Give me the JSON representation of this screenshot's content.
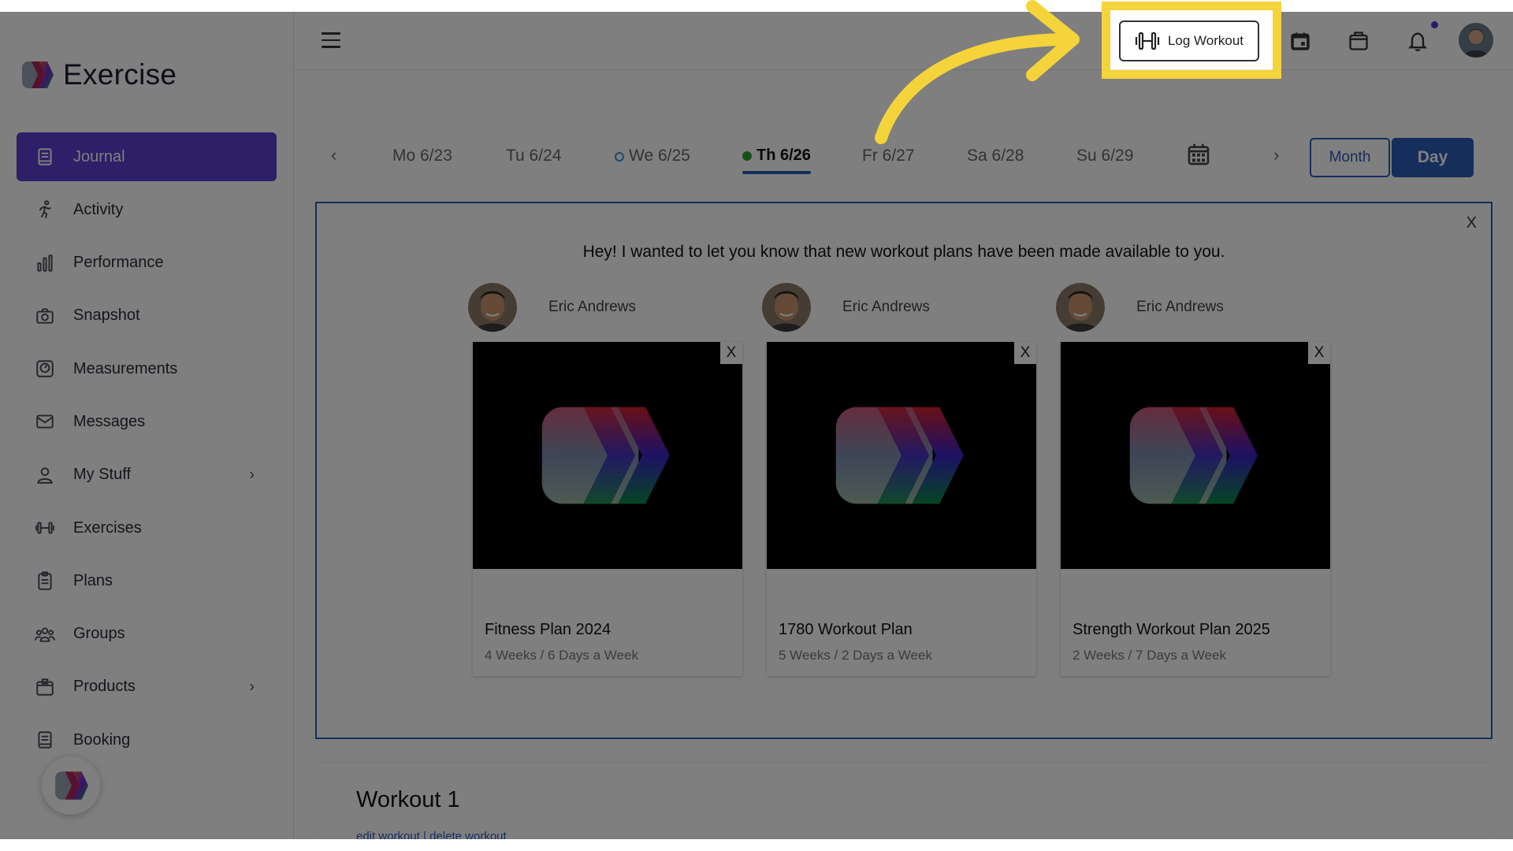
{
  "brand": {
    "name": "Exercise"
  },
  "sidebar": {
    "items": [
      {
        "label": "Journal",
        "icon": "journal-icon",
        "active": true
      },
      {
        "label": "Activity",
        "icon": "running-icon"
      },
      {
        "label": "Performance",
        "icon": "bar-chart-icon"
      },
      {
        "label": "Snapshot",
        "icon": "camera-icon"
      },
      {
        "label": "Measurements",
        "icon": "scale-icon"
      },
      {
        "label": "Messages",
        "icon": "envelope-icon"
      },
      {
        "label": "My Stuff",
        "icon": "user-icon",
        "has_submenu": true
      },
      {
        "label": "Exercises",
        "icon": "dumbbell-icon"
      },
      {
        "label": "Plans",
        "icon": "clipboard-icon"
      },
      {
        "label": "Groups",
        "icon": "group-icon"
      },
      {
        "label": "Products",
        "icon": "box-icon",
        "has_submenu": true
      },
      {
        "label": "Booking",
        "icon": "book-icon"
      }
    ]
  },
  "header": {
    "log_workout_label": "Log Workout"
  },
  "dates": {
    "prev": "‹",
    "next": "›",
    "days": [
      {
        "label": "Mo 6/23"
      },
      {
        "label": "Tu 6/24"
      },
      {
        "label": "We 6/25",
        "marker": "hollow"
      },
      {
        "label": "Th 6/26",
        "marker": "filled",
        "selected": true
      },
      {
        "label": "Fr 6/27"
      },
      {
        "label": "Sa 6/28"
      },
      {
        "label": "Su 6/29"
      }
    ],
    "view_month": "Month",
    "view_day": "Day"
  },
  "panel": {
    "close": "X",
    "message": "Hey! I wanted to let you know that new workout plans have been made available to you.",
    "plans": [
      {
        "author": "Eric Andrews",
        "title": "Fitness Plan 2024",
        "subtitle": "4 Weeks / 6 Days a Week",
        "close": "X"
      },
      {
        "author": "Eric Andrews",
        "title": "1780 Workout Plan",
        "subtitle": "5 Weeks / 2 Days a Week",
        "close": "X"
      },
      {
        "author": "Eric Andrews",
        "title": "Strength Workout Plan 2025",
        "subtitle": "2 Weeks / 7 Days a Week",
        "close": "X"
      }
    ]
  },
  "workout": {
    "title": "Workout 1",
    "edit_link": "edit workout",
    "separator": "|",
    "delete_link": "delete workout"
  },
  "colors": {
    "brand_purple": "#5b3fd0",
    "accent_blue": "#2d5db8",
    "highlight_yellow": "#f5d33a"
  }
}
